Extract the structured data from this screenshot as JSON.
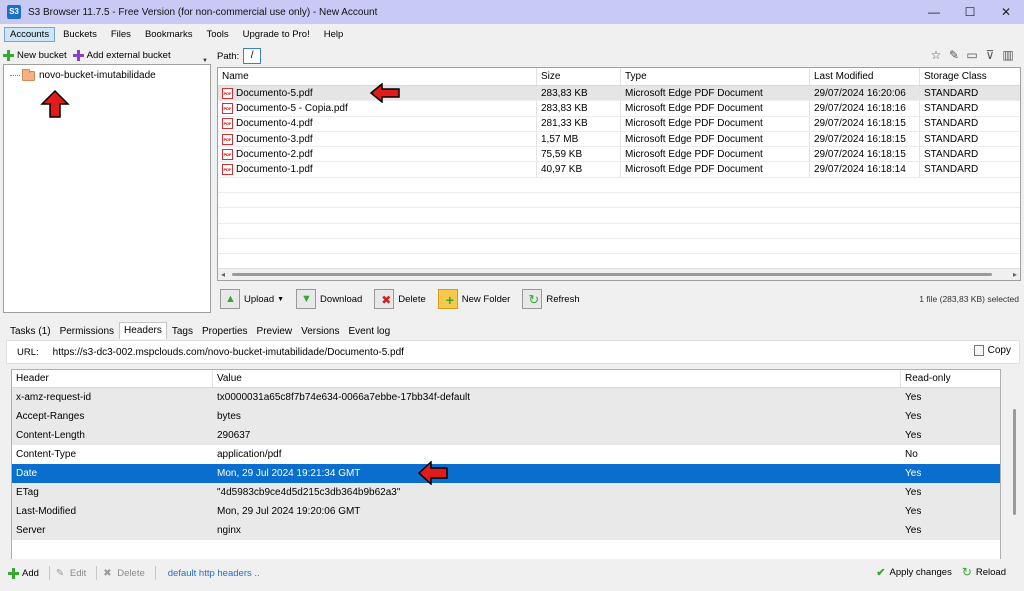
{
  "window": {
    "title": "S3 Browser 11.7.5 - Free Version (for non-commercial use only) - New Account",
    "minimize": "—",
    "maximize": "☐",
    "close": "✕",
    "app_icon": "S3"
  },
  "menu": [
    "Accounts",
    "Buckets",
    "Files",
    "Bookmarks",
    "Tools",
    "Upgrade to Pro!",
    "Help"
  ],
  "left_toolbar": {
    "new_bucket": "New bucket",
    "add_external": "Add external bucket"
  },
  "tree": {
    "bucket": "novo-bucket-imutabilidade"
  },
  "path": {
    "label": "Path:",
    "value": "/"
  },
  "path_icons": [
    "star-icon",
    "pencil-icon",
    "window-icon",
    "filter-icon",
    "columns-icon"
  ],
  "files": {
    "columns": [
      "Name",
      "Size",
      "Type",
      "Last Modified",
      "Storage Class"
    ],
    "rows": [
      {
        "name": "Documento-5.pdf",
        "size": "283,83 KB",
        "type": "Microsoft Edge PDF Document",
        "modified": "29/07/2024 16:20:06",
        "class": "STANDARD"
      },
      {
        "name": "Documento-5 - Copia.pdf",
        "size": "283,83 KB",
        "type": "Microsoft Edge PDF Document",
        "modified": "29/07/2024 16:18:16",
        "class": "STANDARD"
      },
      {
        "name": "Documento-4.pdf",
        "size": "281,33 KB",
        "type": "Microsoft Edge PDF Document",
        "modified": "29/07/2024 16:18:15",
        "class": "STANDARD"
      },
      {
        "name": "Documento-3.pdf",
        "size": "1,57 MB",
        "type": "Microsoft Edge PDF Document",
        "modified": "29/07/2024 16:18:15",
        "class": "STANDARD"
      },
      {
        "name": "Documento-2.pdf",
        "size": "75,59 KB",
        "type": "Microsoft Edge PDF Document",
        "modified": "29/07/2024 16:18:15",
        "class": "STANDARD"
      },
      {
        "name": "Documento-1.pdf",
        "size": "40,97 KB",
        "type": "Microsoft Edge PDF Document",
        "modified": "29/07/2024 16:18:14",
        "class": "STANDARD"
      }
    ],
    "pdf_icon_text": "PDF"
  },
  "actions": {
    "upload": "Upload",
    "download": "Download",
    "delete": "Delete",
    "new_folder": "New Folder",
    "refresh": "Refresh",
    "status": "1 file (283,83 KB) selected"
  },
  "tabs": [
    "Tasks (1)",
    "Permissions",
    "Headers",
    "Tags",
    "Properties",
    "Preview",
    "Versions",
    "Event log"
  ],
  "url": {
    "label": "URL:",
    "value": "https://s3-dc3-002.mspclouds.com/novo-bucket-imutabilidade/Documento-5.pdf",
    "copy": "Copy"
  },
  "headers": {
    "columns": [
      "Header",
      "Value",
      "Read-only"
    ],
    "rows": [
      {
        "header": "x-amz-request-id",
        "value": "tx0000031a65c8f7b74e634-0066a7ebbe-17bb34f-default",
        "ro": "Yes"
      },
      {
        "header": "Accept-Ranges",
        "value": "bytes",
        "ro": "Yes"
      },
      {
        "header": "Content-Length",
        "value": "290637",
        "ro": "Yes"
      },
      {
        "header": "Content-Type",
        "value": "application/pdf",
        "ro": "No"
      },
      {
        "header": "Date",
        "value": "Mon, 29 Jul 2024 19:21:34 GMT",
        "ro": "Yes"
      },
      {
        "header": "ETag",
        "value": "\"4d5983cb9ce4d5d215c3db364b9b62a3\"",
        "ro": "Yes"
      },
      {
        "header": "Last-Modified",
        "value": "Mon, 29 Jul 2024 19:20:06 GMT",
        "ro": "Yes"
      },
      {
        "header": "Server",
        "value": "nginx",
        "ro": "Yes"
      }
    ]
  },
  "bottom": {
    "add": "Add",
    "edit": "Edit",
    "delete": "Delete",
    "link": "default http headers ..",
    "apply": "Apply changes",
    "reload": "Reload"
  },
  "colors": {
    "selection": "#0a6ecf",
    "arrow": "#e11b1b",
    "titlebar": "#c9c9f5"
  }
}
